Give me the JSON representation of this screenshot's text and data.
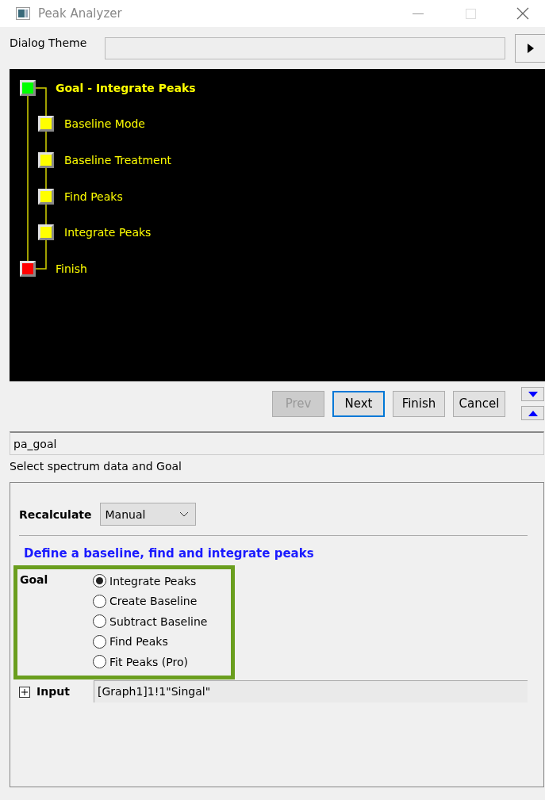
{
  "window": {
    "title": "Peak Analyzer"
  },
  "theme": {
    "label": "Dialog Theme"
  },
  "tree": [
    {
      "label": "Goal - Integrate Peaks",
      "color": "#00ff00",
      "bold": true,
      "children": [
        {
          "label": "Baseline Mode",
          "color": "#ffff00"
        },
        {
          "label": "Baseline Treatment",
          "color": "#ffff00"
        },
        {
          "label": "Find Peaks",
          "color": "#ffff00"
        },
        {
          "label": "Integrate Peaks",
          "color": "#ffff00"
        }
      ]
    },
    {
      "label": "Finish",
      "color": "#ff0000",
      "bold": false
    }
  ],
  "buttons": [
    {
      "label": "Prev",
      "disabled": true,
      "focused": false
    },
    {
      "label": "Next",
      "disabled": false,
      "focused": true
    },
    {
      "label": "Finish",
      "disabled": false,
      "focused": false
    },
    {
      "label": "Cancel",
      "disabled": false,
      "focused": false
    }
  ],
  "name_field": {
    "value": "pa_goal"
  },
  "description": "Select spectrum data and Goal",
  "settings": {
    "recalculate": {
      "label": "Recalculate",
      "value": "Manual"
    },
    "heading": "Define a baseline, find and integrate peaks",
    "goal": {
      "label": "Goal",
      "options": [
        {
          "label": "Integrate Peaks",
          "selected": true
        },
        {
          "label": "Create Baseline",
          "selected": false
        },
        {
          "label": "Subtract Baseline",
          "selected": false
        },
        {
          "label": "Find Peaks",
          "selected": false
        },
        {
          "label": "Fit Peaks (Pro)",
          "selected": false
        }
      ]
    },
    "input": {
      "label": "Input",
      "expanded": false,
      "value": "[Graph1]1!1\"Singal\""
    }
  }
}
